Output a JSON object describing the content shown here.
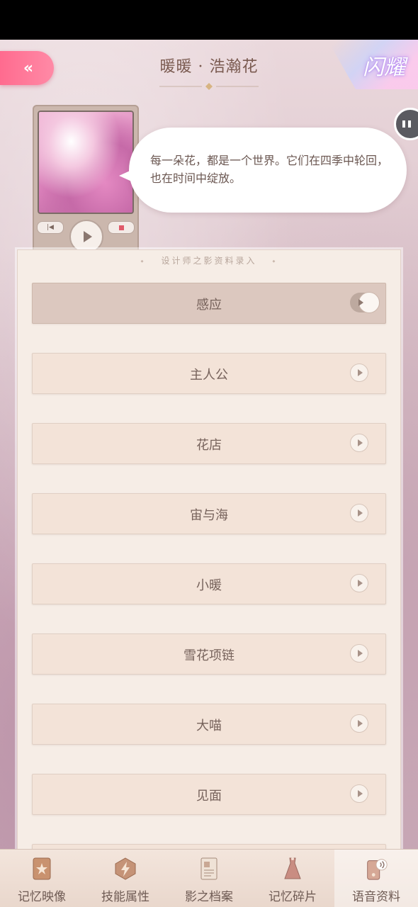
{
  "header": {
    "title": "暖暖 · 浩瀚花",
    "corner_badge_text": "闪耀"
  },
  "bubble": {
    "text": "每一朵花，都是一个世界。它们在四季中轮回，也在时间中绽放。"
  },
  "panel": {
    "header": "设计师之影资料录入",
    "items": [
      {
        "label": "感应",
        "active": true
      },
      {
        "label": "主人公"
      },
      {
        "label": "花店"
      },
      {
        "label": "宙与海"
      },
      {
        "label": "小暖"
      },
      {
        "label": "雪花项链"
      },
      {
        "label": "大喵"
      },
      {
        "label": "见面"
      }
    ]
  },
  "tabs": [
    {
      "label": "记忆映像",
      "icon": "card-star-icon"
    },
    {
      "label": "技能属性",
      "icon": "lightning-icon"
    },
    {
      "label": "影之档案",
      "icon": "document-icon"
    },
    {
      "label": "记忆碎片",
      "icon": "dress-icon"
    },
    {
      "label": "语音资料",
      "icon": "voice-phone-icon",
      "active": true
    }
  ],
  "colors": {
    "back_button": "#ff7395",
    "text_primary": "#76625b",
    "panel_bg": "#f6ede6"
  }
}
